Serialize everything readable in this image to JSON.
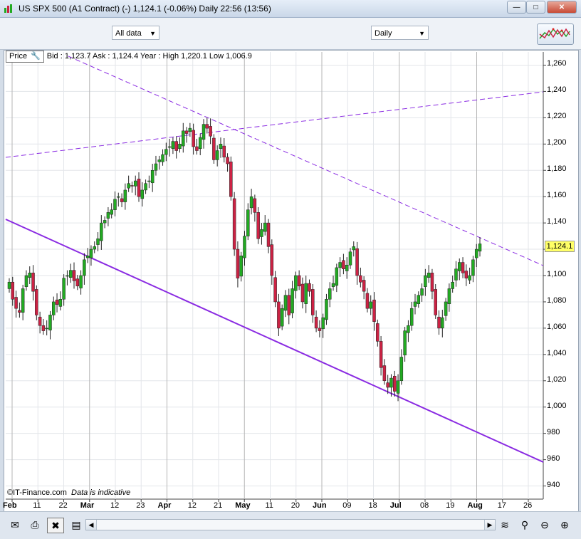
{
  "window": {
    "title": "US SPX 500 (A1 Contract) (-)   1,124.1 (-0.06%)    Daily  22:56 (13:56)"
  },
  "toolbar": {
    "range": "All data",
    "interval": "Daily"
  },
  "quote_bar": {
    "price_label": "Price",
    "text": "Bid : 1,123.7 Ask : 1,124.4  Year : High 1,220.1 Low 1,006.9"
  },
  "footer": {
    "copyright": "©IT-Finance.com",
    "note": "Data is indicative"
  },
  "last_price": "1,124.1",
  "y_ticks": [
    "1,260",
    "1,240",
    "1,220",
    "1,200",
    "1,180",
    "1,160",
    "1,140",
    "1,120",
    "1,100",
    "1,080",
    "1,060",
    "1,040",
    "1,020",
    "1,000",
    "980",
    "960",
    "940"
  ],
  "x_ticks": [
    {
      "label": "Feb",
      "bold": true
    },
    {
      "label": "11",
      "bold": false
    },
    {
      "label": "22",
      "bold": false
    },
    {
      "label": "Mar",
      "bold": true
    },
    {
      "label": "12",
      "bold": false
    },
    {
      "label": "23",
      "bold": false
    },
    {
      "label": "Apr",
      "bold": true
    },
    {
      "label": "12",
      "bold": false
    },
    {
      "label": "21",
      "bold": false
    },
    {
      "label": "May",
      "bold": true
    },
    {
      "label": "11",
      "bold": false
    },
    {
      "label": "20",
      "bold": false
    },
    {
      "label": "Jun",
      "bold": true
    },
    {
      "label": "09",
      "bold": false
    },
    {
      "label": "18",
      "bold": false
    },
    {
      "label": "Jul",
      "bold": true
    },
    {
      "label": "08",
      "bold": false
    },
    {
      "label": "19",
      "bold": false
    },
    {
      "label": "Aug",
      "bold": true
    },
    {
      "label": "17",
      "bold": false
    },
    {
      "label": "26",
      "bold": false
    }
  ],
  "colors": {
    "up": "#22aa22",
    "down": "#cc2244",
    "trend": "#8a2be2"
  },
  "icons": [
    "email-icon",
    "print-icon",
    "erase-icon",
    "save-icon",
    "zoom-fit-icon",
    "zoom-out-icon",
    "zoom-in-icon",
    "indicator-icon"
  ],
  "chart_data": {
    "type": "candlestick",
    "y_range": [
      930,
      1270
    ],
    "close_series": [
      1095,
      1082,
      1075,
      1072,
      1090,
      1100,
      1102,
      1088,
      1070,
      1062,
      1058,
      1060,
      1070,
      1080,
      1078,
      1082,
      1098,
      1100,
      1104,
      1096,
      1092,
      1100,
      1112,
      1115,
      1120,
      1122,
      1128,
      1140,
      1142,
      1148,
      1150,
      1158,
      1160,
      1156,
      1165,
      1170,
      1168,
      1172,
      1160,
      1165,
      1170,
      1172,
      1180,
      1185,
      1188,
      1192,
      1196,
      1198,
      1202,
      1195,
      1200,
      1210,
      1208,
      1212,
      1198,
      1195,
      1205,
      1215,
      1212,
      1206,
      1188,
      1195,
      1200,
      1190,
      1185,
      1160,
      1120,
      1098,
      1115,
      1130,
      1150,
      1160,
      1148,
      1128,
      1135,
      1140,
      1122,
      1100,
      1080,
      1060,
      1075,
      1085,
      1070,
      1090,
      1100,
      1092,
      1080,
      1094,
      1088,
      1070,
      1060,
      1058,
      1068,
      1082,
      1090,
      1094,
      1106,
      1110,
      1105,
      1108,
      1118,
      1122,
      1100,
      1095,
      1088,
      1075,
      1080,
      1065,
      1050,
      1030,
      1020,
      1015,
      1022,
      1012,
      1020,
      1038,
      1058,
      1062,
      1075,
      1080,
      1085,
      1090,
      1100,
      1102,
      1088,
      1070,
      1060,
      1068,
      1080,
      1090,
      1095,
      1105,
      1110,
      1102,
      1098,
      1100,
      1112,
      1120,
      1124.1
    ]
  }
}
